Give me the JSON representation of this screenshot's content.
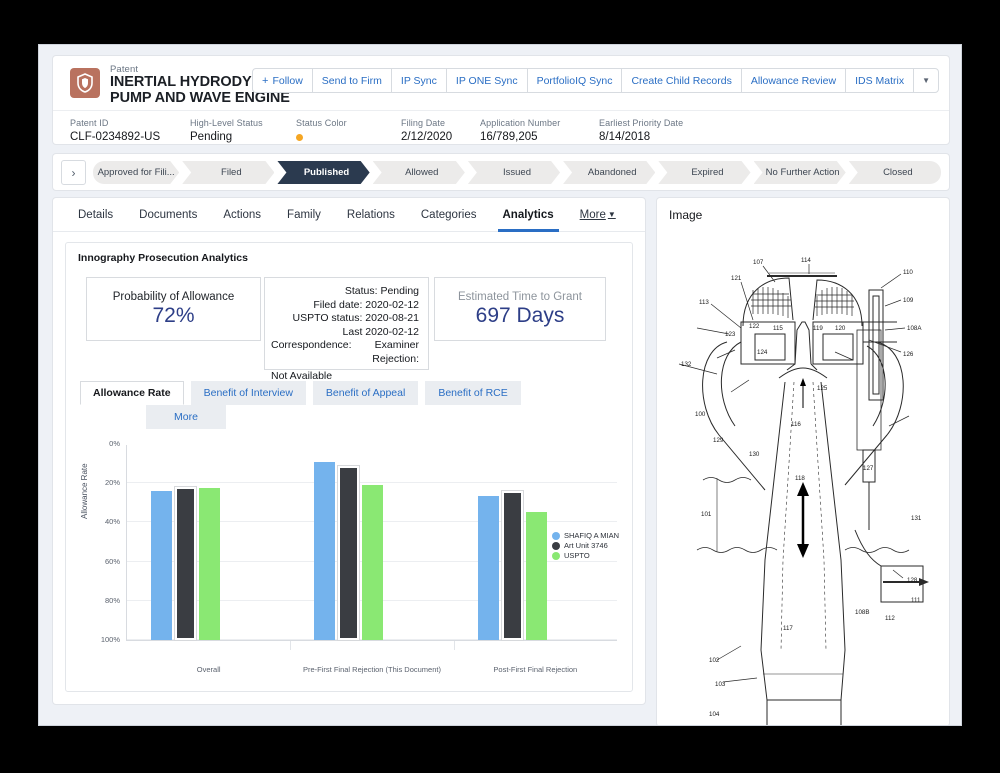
{
  "header": {
    "record_type": "Patent",
    "title": "INERTIAL HYDRODYNAMIC PUMP AND WAVE ENGINE",
    "badge_icon": "shield-icon",
    "actions": [
      {
        "label": "Follow",
        "icon": "plus-icon"
      },
      {
        "label": "Send to Firm"
      },
      {
        "label": "IP Sync"
      },
      {
        "label": "IP ONE Sync"
      },
      {
        "label": "PortfolioIQ Sync"
      },
      {
        "label": "Create Child Records"
      },
      {
        "label": "Allowance Review"
      },
      {
        "label": "IDS Matrix"
      }
    ],
    "overflow_icon": "chevron-down-icon",
    "fields": [
      {
        "label": "Patent ID",
        "value": "CLF-0234892-US"
      },
      {
        "label": "High-Level Status",
        "value": "Pending"
      },
      {
        "label": "Status Color",
        "value": "",
        "color": "#f5a623"
      },
      {
        "label": "Filing Date",
        "value": "2/12/2020"
      },
      {
        "label": "Application Number",
        "value": "16/789,205"
      },
      {
        "label": "Earliest Priority Date",
        "value": "8/14/2018"
      }
    ]
  },
  "path": {
    "prev_icon": "chevron-right-icon",
    "steps": [
      {
        "label": "Approved for Fili...",
        "current": false
      },
      {
        "label": "Filed",
        "current": false
      },
      {
        "label": "Published",
        "current": true
      },
      {
        "label": "Allowed",
        "current": false
      },
      {
        "label": "Issued",
        "current": false
      },
      {
        "label": "Abandoned",
        "current": false
      },
      {
        "label": "Expired",
        "current": false
      },
      {
        "label": "No Further Action",
        "current": false
      },
      {
        "label": "Closed",
        "current": false
      }
    ]
  },
  "tabs": [
    {
      "label": "Details",
      "active": false
    },
    {
      "label": "Documents",
      "active": false
    },
    {
      "label": "Actions",
      "active": false
    },
    {
      "label": "Family",
      "active": false
    },
    {
      "label": "Relations",
      "active": false
    },
    {
      "label": "Categories",
      "active": false
    },
    {
      "label": "Analytics",
      "active": true
    },
    {
      "label": "More",
      "active": false,
      "more": true
    }
  ],
  "panel": {
    "title": "Innography Prosecution Analytics",
    "cards": {
      "probability": {
        "label": "Probability of Allowance",
        "value": "72%"
      },
      "status": {
        "line1": "Status: Pending",
        "line2": "Filed date: 2020-02-12",
        "line3": "USPTO status: 2020-08-21",
        "line4": "Last 2020-02-12",
        "line5": "Correspondence:",
        "line6": "Examiner",
        "line7": "Rejection:",
        "line8": "Not Available"
      },
      "grant": {
        "label": "Estimated Time to Grant",
        "value": "697 Days"
      }
    },
    "subtabs_row1": [
      {
        "label": "Allowance Rate",
        "active": true
      },
      {
        "label": "Benefit of Interview",
        "active": false
      },
      {
        "label": "Benefit of Appeal",
        "active": false
      },
      {
        "label": "Benefit of RCE",
        "active": false
      }
    ],
    "subtabs_row2": [
      {
        "label": "More",
        "active": false
      }
    ]
  },
  "chart_data": {
    "type": "bar",
    "title": "",
    "xlabel": "",
    "ylabel": "Allowance Rate",
    "ylim": [
      0,
      100
    ],
    "yticks": [
      "0%",
      "20%",
      "40%",
      "60%",
      "80%",
      "100%"
    ],
    "ytick_values": [
      0,
      20,
      40,
      60,
      80,
      100
    ],
    "grid": true,
    "legend_position": "right",
    "categories": [
      "Overall",
      "Pre-First Final Rejection (This Document)",
      "Post-First Final Rejection"
    ],
    "series": [
      {
        "name": "SHAFIQ A MIAN",
        "color": "#74b3ed",
        "values": [
          76,
          91,
          73.5
        ]
      },
      {
        "name": "Art Unit 3746",
        "color": "#3a3d42",
        "values": [
          78,
          89,
          76
        ]
      },
      {
        "name": "USPTO",
        "color": "#8ae873",
        "values": [
          77.5,
          79,
          65.5
        ]
      }
    ]
  },
  "image_panel": {
    "title": "Image",
    "figure_name": "patent-drawing",
    "reference_numerals": [
      "100",
      "101",
      "102",
      "103",
      "104",
      "107",
      "108A",
      "108B",
      "109",
      "110",
      "111",
      "112",
      "113",
      "114",
      "115",
      "116",
      "117",
      "118",
      "119",
      "120",
      "121",
      "122",
      "123",
      "124",
      "125",
      "126",
      "127",
      "128",
      "129",
      "130",
      "131",
      "132"
    ]
  }
}
